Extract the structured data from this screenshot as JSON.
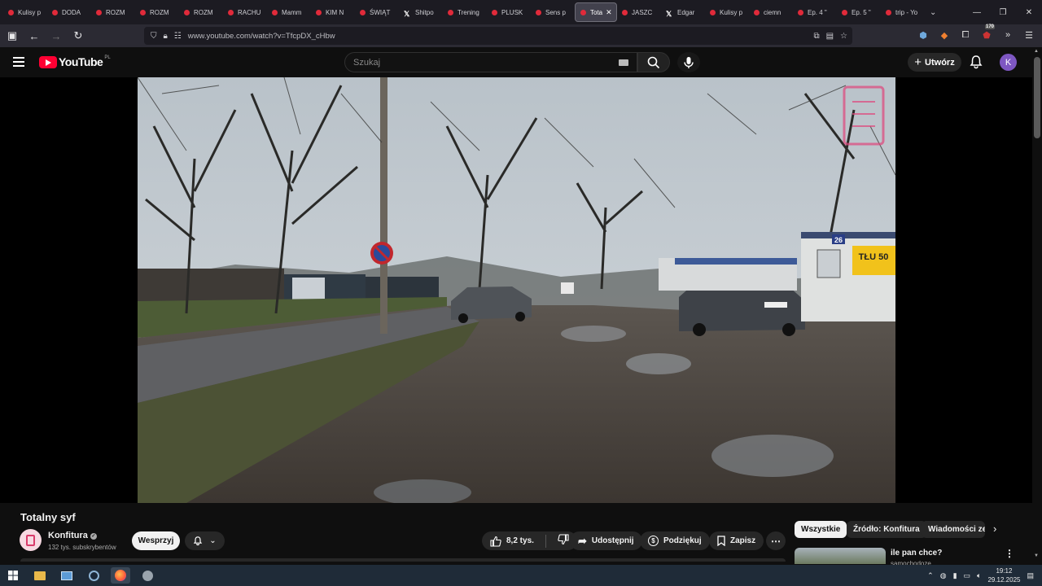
{
  "browser": {
    "tabs": [
      {
        "label": "Kulisy p",
        "icon": "youtube-icon"
      },
      {
        "label": "DODA",
        "icon": "youtube-icon"
      },
      {
        "label": "ROZM",
        "icon": "youtube-icon"
      },
      {
        "label": "ROZM",
        "icon": "youtube-icon"
      },
      {
        "label": "ROZM",
        "icon": "youtube-icon"
      },
      {
        "label": "RACHU",
        "icon": "youtube-icon"
      },
      {
        "label": "Mamm",
        "icon": "youtube-icon"
      },
      {
        "label": "KIM N",
        "icon": "youtube-icon"
      },
      {
        "label": "ŚWIĄT",
        "icon": "youtube-icon"
      },
      {
        "label": "Shitpo",
        "icon": "x-icon"
      },
      {
        "label": "Trening",
        "icon": "youtube-icon"
      },
      {
        "label": "PLUSK",
        "icon": "youtube-icon"
      },
      {
        "label": "Sens p",
        "icon": "youtube-icon"
      },
      {
        "label": "Tota",
        "icon": "youtube-icon",
        "active": true
      },
      {
        "label": "JASZC",
        "icon": "youtube-icon"
      },
      {
        "label": "Edgar",
        "icon": "x-icon"
      },
      {
        "label": "Kulisy p",
        "icon": "youtube-icon"
      },
      {
        "label": "ciemn",
        "icon": "youtube-icon"
      },
      {
        "label": "Ep. 4 \"",
        "icon": "youtube-icon"
      },
      {
        "label": "Ep. 5 \"",
        "icon": "youtube-icon"
      },
      {
        "label": "trip - Yo",
        "icon": "youtube-icon"
      }
    ],
    "url": "www.youtube.com/watch?v=TfcpDX_cHbw",
    "notification_count": "170"
  },
  "youtube": {
    "logo": "YouTube",
    "country_code": "PL",
    "search_placeholder": "Szukaj",
    "create_label": "Utwórz",
    "avatar_initial": "K"
  },
  "video": {
    "title": "Totalny syf",
    "channel_name": "Konfitura",
    "subscribers": "132 tys. subskrybentów",
    "support_label": "Wesprzyj",
    "likes": "8,2 tys.",
    "share_label": "Udostępnij",
    "thanks_label": "Podziękuj",
    "save_label": "Zapisz",
    "sign_text": "TŁU 50",
    "plate_number": "26"
  },
  "sidebar": {
    "chips": [
      "Wszystkie",
      "Źródło: Konfitura",
      "Wiadomości ze"
    ],
    "rec_title": "ile pan chce?",
    "rec_channel": "samochodoze"
  },
  "taskbar": {
    "time": "19:12",
    "date": "29.12.2025"
  },
  "colors": {
    "yt_red": "#ff0033",
    "bg": "#0f0f0f",
    "avatar": "#7e57c2"
  }
}
